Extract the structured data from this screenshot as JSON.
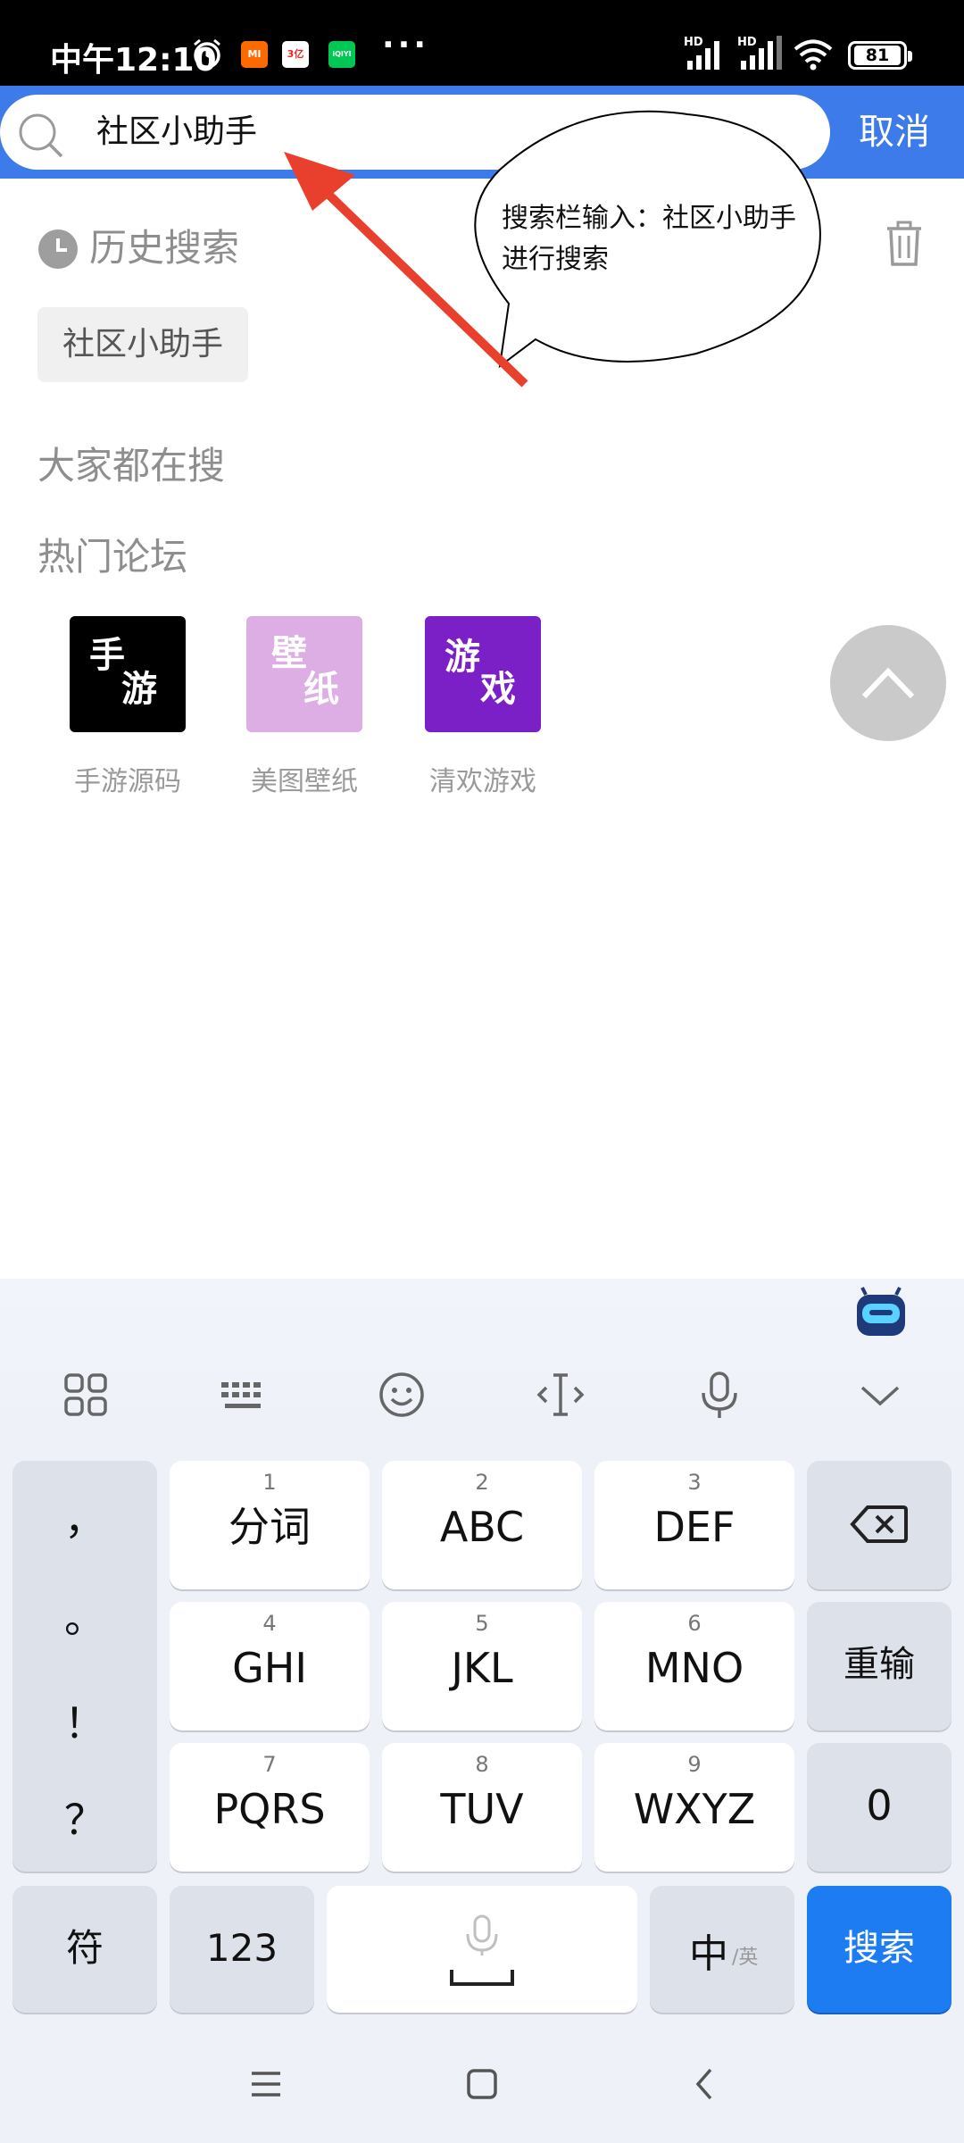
{
  "status_bar": {
    "time": "中午12:10",
    "app_badges": [
      "MI",
      "3亿",
      "iQIYI"
    ],
    "more": "···",
    "network": "HD",
    "battery": "81"
  },
  "search": {
    "query": "社区小助手",
    "cancel_label": "取消"
  },
  "history": {
    "title": "历史搜索",
    "items": [
      "社区小助手"
    ]
  },
  "trending_title": "大家都在搜",
  "forums": {
    "title": "热门论坛",
    "items": [
      {
        "label": "手游源码",
        "tile_chars": [
          "手",
          "游"
        ],
        "color": "#000000"
      },
      {
        "label": "美图壁纸",
        "tile_chars": [
          "壁",
          "纸"
        ],
        "color": "#dcaee3"
      },
      {
        "label": "清欢游戏",
        "tile_chars": [
          "游",
          "戏"
        ],
        "color": "#7b1fc6"
      }
    ]
  },
  "callout": {
    "text": "搜索栏输入：社区小助手　进行搜索",
    "arrow_color": "#e8402c"
  },
  "keyboard": {
    "toolbar_icons": [
      "grid-icon",
      "keyboard-icon",
      "emoji-icon",
      "cursor-icon",
      "mic-icon",
      "collapse-icon"
    ],
    "punctuation": [
      "，",
      "。",
      "！",
      "？"
    ],
    "rows": [
      [
        {
          "num": "1",
          "label": "分词"
        },
        {
          "num": "2",
          "label": "ABC"
        },
        {
          "num": "3",
          "label": "DEF"
        }
      ],
      [
        {
          "num": "4",
          "label": "GHI"
        },
        {
          "num": "5",
          "label": "JKL"
        },
        {
          "num": "6",
          "label": "MNO"
        }
      ],
      [
        {
          "num": "7",
          "label": "PQRS"
        },
        {
          "num": "8",
          "label": "TUV"
        },
        {
          "num": "9",
          "label": "WXYZ"
        }
      ]
    ],
    "reenter_label": "重输",
    "zero_label": "0",
    "symbols_label": "符",
    "numbers_label": "123",
    "lang_main": "中",
    "lang_alt": "/英",
    "search_label": "搜索",
    "accent": "#1e7cf2"
  },
  "nav_bar": {
    "icons": [
      "menu-icon",
      "home-icon",
      "back-icon"
    ]
  }
}
